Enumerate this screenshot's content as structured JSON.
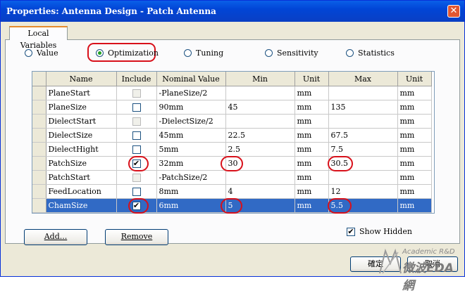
{
  "window": {
    "title": "Properties: Antenna Design - Patch Antenna",
    "close_glyph": "✕"
  },
  "tab": {
    "label": "Local Variables"
  },
  "radios": [
    {
      "label": "Value",
      "selected": false
    },
    {
      "label": "Optimization",
      "selected": true
    },
    {
      "label": "Tuning",
      "selected": false
    },
    {
      "label": "Sensitivity",
      "selected": false
    },
    {
      "label": "Statistics",
      "selected": false
    }
  ],
  "table": {
    "headers": [
      "Name",
      "Include",
      "Nominal Value",
      "Min",
      "Unit",
      "Max",
      "Unit"
    ],
    "rows": [
      {
        "name": "PlaneStart",
        "include": "disabled",
        "nominal": "-PlaneSize/2",
        "min": "",
        "min_unit": "mm",
        "max": "",
        "max_unit": "mm",
        "selected": false
      },
      {
        "name": "PlaneSize",
        "include": "unchecked",
        "nominal": "90mm",
        "min": "45",
        "min_unit": "mm",
        "max": "135",
        "max_unit": "mm",
        "selected": false
      },
      {
        "name": "DielectStart",
        "include": "disabled",
        "nominal": "-DielectSize/2",
        "min": "",
        "min_unit": "mm",
        "max": "",
        "max_unit": "mm",
        "selected": false
      },
      {
        "name": "DielectSize",
        "include": "unchecked",
        "nominal": "45mm",
        "min": "22.5",
        "min_unit": "mm",
        "max": "67.5",
        "max_unit": "mm",
        "selected": false
      },
      {
        "name": "DielectHight",
        "include": "unchecked",
        "nominal": "5mm",
        "min": "2.5",
        "min_unit": "mm",
        "max": "7.5",
        "max_unit": "mm",
        "selected": false
      },
      {
        "name": "PatchSize",
        "include": "checked",
        "nominal": "32mm",
        "min": "30",
        "min_unit": "mm",
        "max": "30.5",
        "max_unit": "mm",
        "selected": false
      },
      {
        "name": "PatchStart",
        "include": "disabled",
        "nominal": "-PatchSize/2",
        "min": "",
        "min_unit": "mm",
        "max": "",
        "max_unit": "mm",
        "selected": false
      },
      {
        "name": "FeedLocation",
        "include": "unchecked",
        "nominal": "8mm",
        "min": "4",
        "min_unit": "mm",
        "max": "12",
        "max_unit": "mm",
        "selected": false
      },
      {
        "name": "ChamSize",
        "include": "checked",
        "nominal": "6mm",
        "min": "5",
        "min_unit": "mm",
        "max": "5.5",
        "max_unit": "mm",
        "selected": true
      }
    ]
  },
  "buttons": {
    "add": "Add...",
    "remove": "Remove",
    "ok": "確定",
    "cancel": "取消"
  },
  "show_hidden": {
    "label": "Show Hidden",
    "checked": true
  },
  "watermark": {
    "top": "Academic R&D",
    "bottom": "微波EDA網"
  },
  "colors": {
    "accent_ring": "#d8101a",
    "selection": "#316ac5",
    "titlebar": "#0145d6"
  }
}
